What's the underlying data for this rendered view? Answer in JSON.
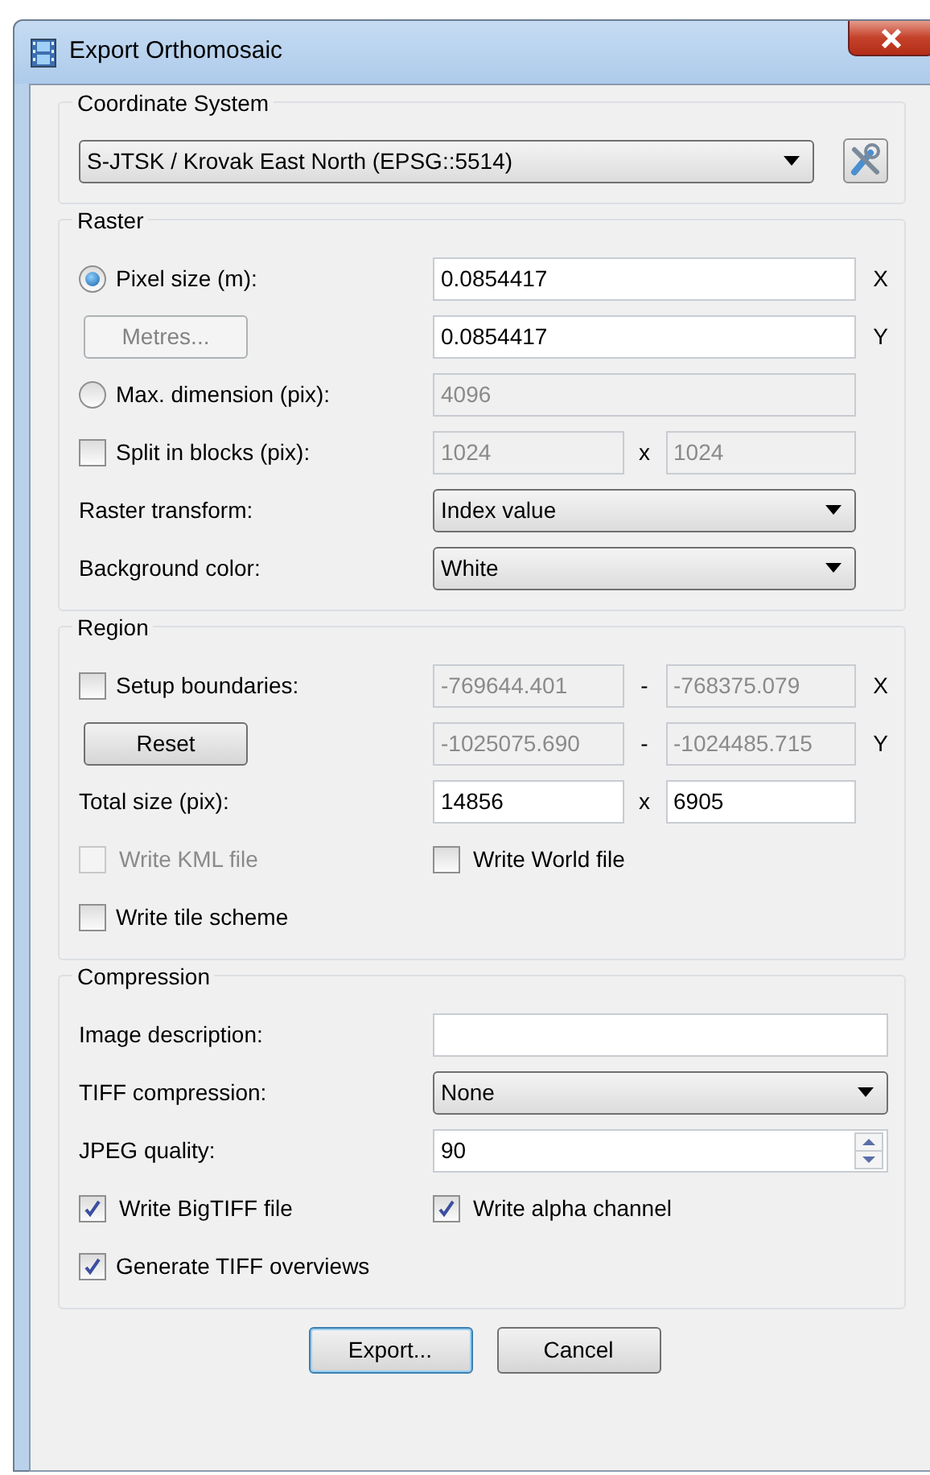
{
  "window": {
    "title": "Export Orthomosaic"
  },
  "groups": [
    {
      "title": "Coordinate System",
      "rows": [
        {
          "kind": "plain",
          "fields": [
            {
              "kind": "dropdown",
              "value": "S-JTSK / Krovak East North (EPSG::5514)"
            }
          ],
          "tool_button": true
        }
      ]
    },
    {
      "title": "Raster",
      "rows": [
        {
          "kind": "radio",
          "label": "Pixel size (m):",
          "selected": true,
          "fields": [
            {
              "kind": "text",
              "value": "0.0854417",
              "disabled": false
            }
          ],
          "suffix": "X"
        },
        {
          "kind": "button",
          "label": "Metres...",
          "disabled": true,
          "fields": [
            {
              "kind": "text",
              "value": "0.0854417",
              "disabled": false
            }
          ],
          "suffix": "Y"
        },
        {
          "kind": "radio",
          "label": "Max. dimension (pix):",
          "selected": false,
          "fields": [
            {
              "kind": "text",
              "value": "4096",
              "disabled": true
            }
          ]
        },
        {
          "kind": "checkbox",
          "label": "Split in blocks (pix):",
          "checked": false,
          "disabled": false,
          "fields": [
            {
              "kind": "text",
              "value": "1024",
              "disabled": true
            },
            {
              "kind": "text",
              "value": "1024",
              "disabled": true
            }
          ],
          "separator": "x"
        },
        {
          "kind": "plain",
          "label": "Raster transform:",
          "fields": [
            {
              "kind": "dropdown",
              "value": "Index value"
            }
          ]
        },
        {
          "kind": "plain",
          "label": "Background color:",
          "fields": [
            {
              "kind": "dropdown",
              "value": "White"
            }
          ]
        }
      ]
    },
    {
      "title": "Region",
      "rows": [
        {
          "kind": "checkbox",
          "label": "Setup boundaries:",
          "checked": false,
          "disabled": false,
          "fields": [
            {
              "kind": "text",
              "value": "-769644.401",
              "disabled": true
            },
            {
              "kind": "text",
              "value": "-768375.079",
              "disabled": true
            }
          ],
          "separator": "-",
          "suffix": "X"
        },
        {
          "kind": "button",
          "label": "Reset",
          "disabled": false,
          "fields": [
            {
              "kind": "text",
              "value": "-1025075.690",
              "disabled": true
            },
            {
              "kind": "text",
              "value": "-1024485.715",
              "disabled": true
            }
          ],
          "separator": "-",
          "suffix": "Y"
        },
        {
          "kind": "plain",
          "label": "Total size (pix):",
          "fields": [
            {
              "kind": "text",
              "value": "14856",
              "disabled": false
            },
            {
              "kind": "text",
              "value": "6905",
              "disabled": false
            }
          ],
          "separator": "x"
        },
        {
          "kind": "checkpair",
          "items": [
            {
              "label": "Write KML file",
              "checked": false,
              "disabled": true
            },
            {
              "label": "Write World file",
              "checked": false,
              "disabled": false
            }
          ]
        },
        {
          "kind": "checkbox",
          "label": "Write tile scheme",
          "checked": false,
          "disabled": false
        }
      ]
    },
    {
      "title": "Compression",
      "rows": [
        {
          "kind": "plain",
          "label": "Image description:",
          "fields": [
            {
              "kind": "text",
              "disabled": false
            }
          ]
        },
        {
          "kind": "plain",
          "label": "TIFF compression:",
          "fields": [
            {
              "kind": "dropdown",
              "value": "None"
            }
          ]
        },
        {
          "kind": "plain",
          "label": "JPEG quality:",
          "fields": [
            {
              "kind": "spin",
              "value": "90"
            }
          ]
        },
        {
          "kind": "checkpair",
          "items": [
            {
              "label": "Write BigTIFF file",
              "checked": true,
              "disabled": false
            },
            {
              "label": "Write alpha channel",
              "checked": true,
              "disabled": false
            }
          ]
        },
        {
          "kind": "checkbox",
          "label": "Generate TIFF overviews",
          "checked": true,
          "disabled": false
        }
      ]
    }
  ],
  "buttons": [
    {
      "label": "Export...",
      "default": true
    },
    {
      "label": "Cancel",
      "default": false
    }
  ]
}
